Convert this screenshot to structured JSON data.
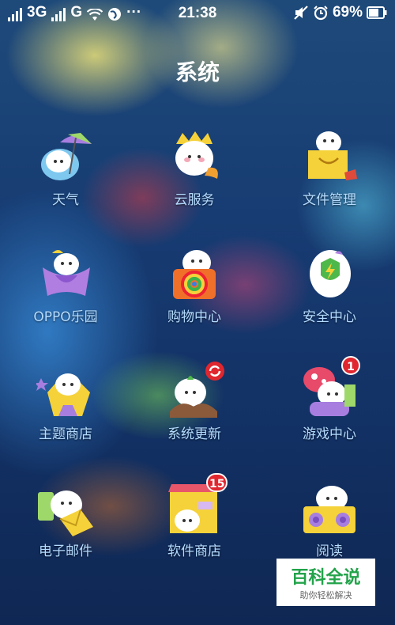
{
  "status_bar": {
    "network_1": "3G",
    "network_2": "G",
    "more": "···",
    "time": "21:38",
    "battery": "69%"
  },
  "page": {
    "title": "系统"
  },
  "apps": [
    {
      "label": "天气",
      "icon": "weather-icon"
    },
    {
      "label": "云服务",
      "icon": "cloud-service-icon"
    },
    {
      "label": "文件管理",
      "icon": "file-manager-icon"
    },
    {
      "label": "OPPO乐园",
      "icon": "oppo-paradise-icon"
    },
    {
      "label": "购物中心",
      "icon": "shopping-center-icon"
    },
    {
      "label": "安全中心",
      "icon": "security-center-icon"
    },
    {
      "label": "主题商店",
      "icon": "theme-store-icon"
    },
    {
      "label": "系统更新",
      "icon": "system-update-icon"
    },
    {
      "label": "游戏中心",
      "icon": "game-center-icon",
      "badge": "1"
    },
    {
      "label": "电子邮件",
      "icon": "email-icon"
    },
    {
      "label": "软件商店",
      "icon": "software-store-icon",
      "badge": "15"
    },
    {
      "label": "阅读",
      "icon": "reading-icon"
    }
  ],
  "watermark": {
    "title": "百科全说",
    "subtitle": "助你轻松解决"
  },
  "colors": {
    "label": "#b5dcff",
    "badge": "#e0262e",
    "watermark_green": "#22a34a"
  }
}
